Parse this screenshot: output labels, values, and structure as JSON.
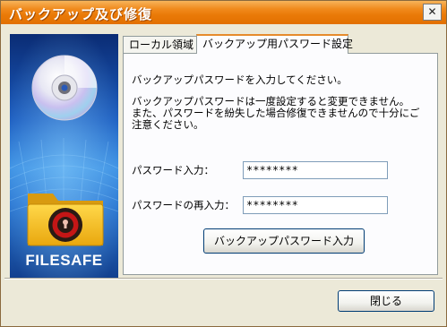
{
  "window": {
    "title": "バックアップ及び修復",
    "close_glyph": "✕"
  },
  "left_panel": {
    "brand": "FILESAFE",
    "icons": [
      "disc-icon",
      "folder-lock-icon"
    ]
  },
  "tabs": [
    {
      "label": "ローカル領域",
      "active": false
    },
    {
      "label": "バックアップ用パスワード設定",
      "active": true
    }
  ],
  "content": {
    "intro": "バックアップパスワードを入力してください。",
    "warning_lines": [
      "バックアップパスワードは一度設定すると変更できません。",
      "また、パスワードを紛失した場合修復できませんので十分にご",
      "注意ください。"
    ],
    "password_label": "パスワード入力：",
    "password_value": "********",
    "confirm_label": "パスワードの再入力：",
    "confirm_value": "********",
    "submit_button": "バックアップパスワード入力"
  },
  "footer": {
    "close_button": "閉じる"
  },
  "colors": {
    "titlebar": "#ea7a08",
    "tab_accent": "#e68b2c",
    "panel_blue": "#1a5bbf",
    "folder_yellow": "#f6c02a"
  }
}
